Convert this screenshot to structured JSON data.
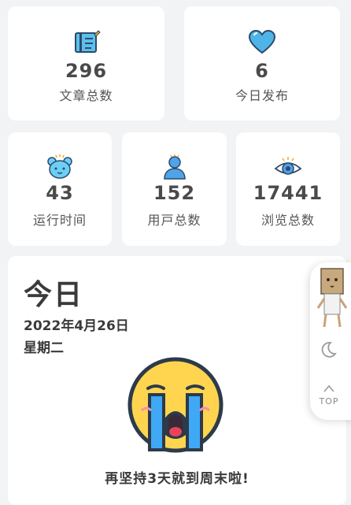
{
  "stats": {
    "articles": {
      "value": "296",
      "label": "文章总数",
      "icon": "notebook-icon"
    },
    "today_posts": {
      "value": "6",
      "label": "今日发布",
      "icon": "heart-icon"
    },
    "uptime": {
      "value": "43",
      "label": "运行时间",
      "icon": "bear-clock-icon"
    },
    "users": {
      "value": "152",
      "label": "用戸总数",
      "icon": "user-icon"
    },
    "views": {
      "value": "17441",
      "label": "浏览总数",
      "icon": "eye-icon"
    }
  },
  "today": {
    "title": "今日",
    "date": "2022年4月26日",
    "weekday": "星期二",
    "message": "再坚持3天就到周末啦!",
    "icon": "crying-face-icon"
  },
  "side_panel": {
    "mascot_icon": "box-head-mascot-icon",
    "theme_icon": "moon-icon",
    "top_label": "TOP",
    "top_icon": "chevron-up-icon"
  },
  "colors": {
    "background": "#f1f3f5",
    "card": "#ffffff",
    "accent_blue": "#4fb5e8",
    "face_yellow": "#ffd54f"
  }
}
